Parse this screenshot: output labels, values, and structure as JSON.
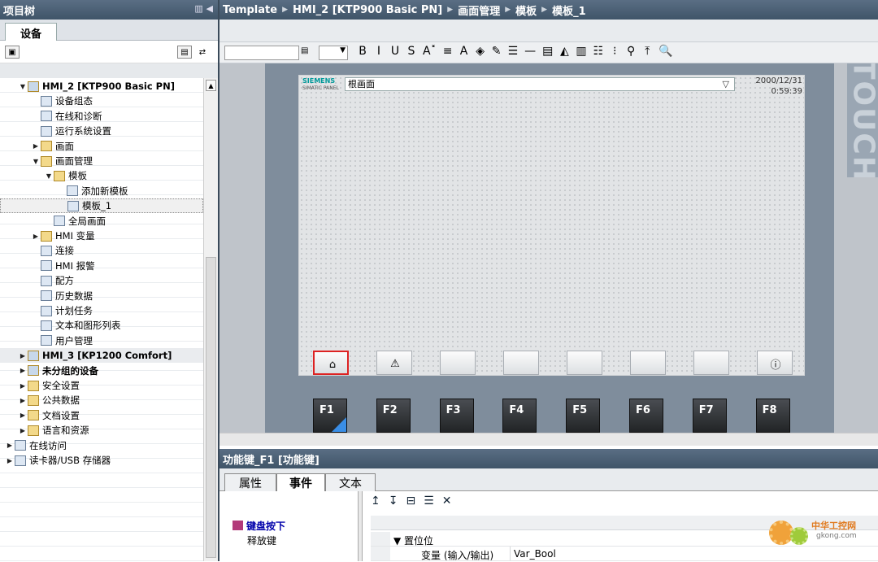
{
  "project_tree": {
    "title": "项目树",
    "tab": "设备",
    "items": [
      {
        "label": "HMI_2 [KTP900 Basic PN]",
        "arrow": "▼",
        "indent": 0,
        "bold": true
      },
      {
        "label": "设备组态",
        "arrow": "",
        "indent": 1
      },
      {
        "label": "在线和诊断",
        "arrow": "",
        "indent": 1
      },
      {
        "label": "运行系统设置",
        "arrow": "",
        "indent": 1
      },
      {
        "label": "画面",
        "arrow": "▶",
        "indent": 1
      },
      {
        "label": "画面管理",
        "arrow": "▼",
        "indent": 1
      },
      {
        "label": "模板",
        "arrow": "▼",
        "indent": 2
      },
      {
        "label": "添加新模板",
        "arrow": "",
        "indent": 3
      },
      {
        "label": "模板_1",
        "arrow": "",
        "indent": 3,
        "selected": true
      },
      {
        "label": "全局画面",
        "arrow": "",
        "indent": 2
      },
      {
        "label": "HMI 变量",
        "arrow": "▶",
        "indent": 1
      },
      {
        "label": "连接",
        "arrow": "",
        "indent": 1
      },
      {
        "label": "HMI 报警",
        "arrow": "",
        "indent": 1
      },
      {
        "label": "配方",
        "arrow": "",
        "indent": 1
      },
      {
        "label": "历史数据",
        "arrow": "",
        "indent": 1
      },
      {
        "label": "计划任务",
        "arrow": "",
        "indent": 1
      },
      {
        "label": "文本和图形列表",
        "arrow": "",
        "indent": 1
      },
      {
        "label": "用户管理",
        "arrow": "",
        "indent": 1
      },
      {
        "label": "HMI_3 [KP1200 Comfort]",
        "arrow": "▶",
        "indent": 0,
        "bold": true,
        "band": true
      },
      {
        "label": "未分组的设备",
        "arrow": "▶",
        "indent": 0,
        "bold": true
      },
      {
        "label": "安全设置",
        "arrow": "▶",
        "indent": 0
      },
      {
        "label": "公共数据",
        "arrow": "▶",
        "indent": 0
      },
      {
        "label": "文档设置",
        "arrow": "▶",
        "indent": 0
      },
      {
        "label": "语言和资源",
        "arrow": "▶",
        "indent": 0
      },
      {
        "label": "在线访问",
        "arrow": "▶",
        "indent": -1
      },
      {
        "label": "读卡器/USB 存储器",
        "arrow": "▶",
        "indent": -1
      }
    ]
  },
  "breadcrumb": [
    "Template",
    "HMI_2 [KTP900 Basic PN]",
    "画面管理",
    "模板",
    "模板_1"
  ],
  "format_toolbar": [
    "B",
    "I",
    "U",
    "S",
    "A˟",
    "≡",
    "A",
    "◈",
    "✎",
    "☰",
    "—",
    "▤",
    "◭",
    "▥",
    "☷",
    "⁝",
    "⚲",
    "⤒",
    "🔍"
  ],
  "hmi": {
    "brand": "SIEMENS",
    "brand_sub": "SIMATIC PANEL",
    "screen_dropdown": "根画面",
    "date": "2000/12/31",
    "time": "0:59:39",
    "touch": "TOUCH",
    "function_keys": [
      "F1",
      "F2",
      "F3",
      "F4",
      "F5",
      "F6",
      "F7",
      "F8"
    ]
  },
  "inspector": {
    "title": "功能键_F1 [功能键]",
    "tabs": [
      "属性",
      "事件",
      "文本"
    ],
    "events": [
      "键盘按下",
      "释放键"
    ],
    "rows": [
      {
        "name": "置位位",
        "value": ""
      },
      {
        "name": "变量 (输入/输出)",
        "value": "Var_Bool"
      }
    ]
  },
  "watermark": {
    "text": "中华工控网",
    "url": "gkong.com"
  }
}
